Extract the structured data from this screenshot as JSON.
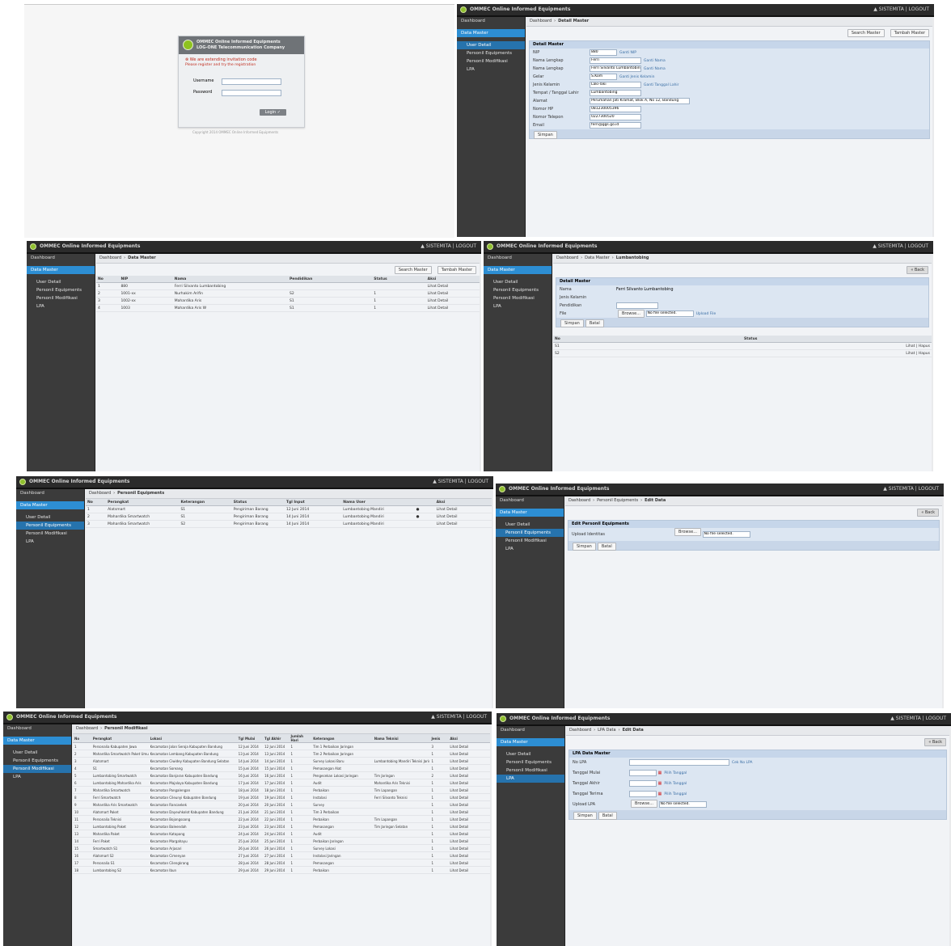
{
  "app": {
    "title": "OMMEC Online Informed Equipments",
    "user": "▲ SISTEMITA | LOGOUT"
  },
  "nav": {
    "dashboard": "Dashboard",
    "data_master": "Data Master",
    "user_detail": "User Detail",
    "personil_equipment": "Personil Equipments",
    "personil_modifikasi": "Personil Modifikasi",
    "lpa": "LPA"
  },
  "login": {
    "head_line1": "OMMEC Online Informed Equipments",
    "head_line2": "LOG-ONE Telecommunication Company",
    "error_line1": "⊗ We are extending invitation code",
    "error_line2": "Please register and try the registration",
    "username_label": "Username",
    "password_label": "Password",
    "login_button": "Login ✓",
    "footer": "Copyright 2014 OMMEC Online Informed Equipments"
  },
  "profile_form": {
    "crumb_home": "Dashboard",
    "crumb_current": "Detail Master",
    "btn_1": "Search Master",
    "btn_2": "Tambah Master",
    "section_title": "Detail Master",
    "fields": [
      {
        "label": "NIP",
        "value": "880"
      },
      {
        "label": "Nama Lengkap",
        "value": "Ferri"
      },
      {
        "label": "Nama Lengkap",
        "value": "Ferri Silvanto Lumbantobing"
      },
      {
        "label": "Gelar",
        "value": "S.Kom"
      },
      {
        "label": "Jenis Kelamin",
        "value": "Laki-laki"
      },
      {
        "label": "Tempat / Tanggal Lahir",
        "value": "Lumbantobing"
      },
      {
        "label": "Alamat",
        "value": "Perumahan Jati Kramat, Blok A, No 12, Bandung"
      },
      {
        "label": "Nomor HP",
        "value": "081230005396"
      },
      {
        "label": "Nomor Telepon",
        "value": "0227300520"
      },
      {
        "label": "Email",
        "value": "ferri@ggs.go.id"
      }
    ],
    "links": [
      "Ganti NIP",
      "Ganti Nama",
      "Ganti Nama",
      "Ganti Jenis Kelamin",
      "Ganti Tanggal Lahir"
    ],
    "save_button": "Simpan"
  },
  "user_list": {
    "crumb_home": "Dashboard",
    "crumb_current": "Data Master",
    "btn_1": "Search Master",
    "btn_2": "Tambah Master",
    "headers": [
      "No",
      "NIP",
      "Nama",
      "Pendidikan",
      "Status",
      "Aksi"
    ],
    "rows": [
      [
        "1",
        "880",
        "Ferri Silvanto Lumbantobing",
        "",
        "",
        "Lihat Detail"
      ],
      [
        "2",
        "1001-xx",
        "Nurhakim Arifin",
        "S2",
        "1",
        "Lihat Detail"
      ],
      [
        "3",
        "1002-xx",
        "Mahardika Aris",
        "S1",
        "1",
        "Lihat Detail"
      ],
      [
        "4",
        "1003",
        "Mahardika Aris W",
        "S1",
        "1",
        "Lihat Detail"
      ]
    ]
  },
  "user_detail": {
    "crumbs": [
      "Dashboard",
      "Data Master",
      "Lumbantobing"
    ],
    "back_button": "« Back",
    "section_title": "Detail Master",
    "fields": [
      {
        "label": "Nama",
        "value": "Ferri Silvanto Lumbantobing"
      },
      {
        "label": "Jenis Kelamin",
        "value": ""
      },
      {
        "label": "Pendidikan",
        "value": ""
      },
      {
        "label": "File",
        "value": "No file selected."
      }
    ],
    "browse_button": "Browse...",
    "upload_link": "Upload File",
    "btn_save": "Simpan",
    "btn_cancel": "Batal",
    "headers": [
      "No",
      "Status"
    ],
    "rows": [
      [
        "S1",
        "Lihat | Hapus"
      ],
      [
        "S2",
        "Lihat | Hapus"
      ]
    ]
  },
  "equip_list": {
    "crumb_home": "Dashboard",
    "crumb_current": "Personil Equipments",
    "headers": [
      "No",
      "Perangkat",
      "Keterangan",
      "Status",
      "Tgl Input",
      "Nama User",
      "",
      "Aksi"
    ],
    "rows": [
      [
        "1",
        "Alatsmart",
        "S1",
        "Pengiriman Barang",
        "12 Juni 2014",
        "Lumbantobing Mandiri",
        "●",
        "Lihat Detail"
      ],
      [
        "2",
        "Mahardika Smartwatch",
        "S1",
        "Pengiriman Barang",
        "14 Juni 2014",
        "Lumbantobing Mandiri",
        "●",
        "Lihat Detail"
      ],
      [
        "3",
        "Mahardika Smartwatch",
        "S2",
        "Pengiriman Barang",
        "14 Juni 2014",
        "Lumbantobing Mandiri",
        "",
        "Lihat Detail"
      ]
    ]
  },
  "equip_edit": {
    "crumbs": [
      "Dashboard",
      "Personil Equipments",
      "Edit Data"
    ],
    "back_button": "« Back",
    "section_title": "Edit Personil Equipments",
    "file_label": "Upload Identitas",
    "browse_button": "Browse...",
    "no_file": "No file selected.",
    "btn_save": "Simpan",
    "btn_cancel": "Batal"
  },
  "modif_list": {
    "crumb_home": "Dashboard",
    "crumb_current": "Personil Modifikasi",
    "headers": [
      "No",
      "Perangkat",
      "Lokasi",
      "Tgl Mulai",
      "Tgl Akhir",
      "Jumlah Hari",
      "Keterangan",
      "Nama Teknisi",
      "Jenis",
      "Aksi"
    ],
    "rows": [
      [
        "1",
        "Personalia Kabupaten Jawa",
        "Kecamatan Jalan Seroja Kabupaten Bandung",
        "12 Juni 2014",
        "12 Juni 2014",
        "1",
        "Tim 1 Perbaikan Jaringan",
        "",
        "3",
        "Lihat Detail"
      ],
      [
        "2",
        "Mahardika Smartwatch Paket Umum",
        "Kecamatan Lembang Kabupaten Bandung",
        "13 Juni 2014",
        "13 Juni 2014",
        "1",
        "Tim 2 Perbaikan Jaringan",
        "",
        "1",
        "Lihat Detail"
      ],
      [
        "3",
        "Alatsmart",
        "Kecamatan Ciwidey Kabupaten Bandung Selatan",
        "14 Juni 2014",
        "14 Juni 2014",
        "1",
        "Survey Lokasi Baru",
        "Lumbantobing Mandiri Teknisi Jaringan",
        "1",
        "Lihat Detail"
      ],
      [
        "4",
        "S1",
        "Kecamatan Soreang",
        "15 Juni 2014",
        "15 Juni 2014",
        "1",
        "Pemasangan Alat",
        "",
        "1",
        "Lihat Detail"
      ],
      [
        "5",
        "Lumbantobing Smartwatch",
        "Kecamatan Banjaran Kabupaten Bandung",
        "16 Juni 2014",
        "16 Juni 2014",
        "1",
        "Pengecekan Lokasi Jaringan",
        "Tim Jaringan",
        "2",
        "Lihat Detail"
      ],
      [
        "6",
        "Lumbantobing Mahardika Aris",
        "Kecamatan Majalaya Kabupaten Bandung",
        "17 Juni 2014",
        "17 Juni 2014",
        "1",
        "Audit",
        "Mahardika Aris Teknisi",
        "1",
        "Lihat Detail"
      ],
      [
        "7",
        "Mahardika Smartwatch",
        "Kecamatan Pangalengan",
        "18 Juni 2014",
        "18 Juni 2014",
        "1",
        "Perbaikan",
        "Tim Lapangan",
        "1",
        "Lihat Detail"
      ],
      [
        "8",
        "Ferri Smartwatch",
        "Kecamatan Cileunyi Kabupaten Bandung",
        "19 Juni 2014",
        "19 Juni 2014",
        "1",
        "Instalasi",
        "Ferri Silvanto Teknisi",
        "1",
        "Lihat Detail"
      ],
      [
        "9",
        "Mahardika Aris Smartwatch",
        "Kecamatan Rancaekek",
        "20 Juni 2014",
        "20 Juni 2014",
        "1",
        "Survey",
        "",
        "1",
        "Lihat Detail"
      ],
      [
        "10",
        "Alatsmart Paket",
        "Kecamatan Dayeuhkolot Kabupaten Bandung",
        "21 Juni 2014",
        "21 Juni 2014",
        "1",
        "Tim 3 Perbaikan",
        "",
        "1",
        "Lihat Detail"
      ],
      [
        "11",
        "Personalia Teknisi",
        "Kecamatan Bojongsoang",
        "22 Juni 2014",
        "22 Juni 2014",
        "1",
        "Perbaikan",
        "Tim Lapangan",
        "1",
        "Lihat Detail"
      ],
      [
        "12",
        "Lumbantobing Paket",
        "Kecamatan Baleendah",
        "23 Juni 2014",
        "23 Juni 2014",
        "1",
        "Pemasangan",
        "Tim Jaringan Selatan",
        "1",
        "Lihat Detail"
      ],
      [
        "13",
        "Mahardika Paket",
        "Kecamatan Katapang",
        "24 Juni 2014",
        "24 Juni 2014",
        "1",
        "Audit",
        "",
        "1",
        "Lihat Detail"
      ],
      [
        "14",
        "Ferri Paket",
        "Kecamatan Margahayu",
        "25 Juni 2014",
        "25 Juni 2014",
        "1",
        "Perbaikan Jaringan",
        "",
        "1",
        "Lihat Detail"
      ],
      [
        "15",
        "Smartwatch S1",
        "Kecamatan Arjasari",
        "26 Juni 2014",
        "26 Juni 2014",
        "1",
        "Survey Lokasi",
        "",
        "1",
        "Lihat Detail"
      ],
      [
        "16",
        "Alatsmart S2",
        "Kecamatan Cimenyan",
        "27 Juni 2014",
        "27 Juni 2014",
        "1",
        "Instalasi Jaringan",
        "",
        "1",
        "Lihat Detail"
      ],
      [
        "17",
        "Personalia S1",
        "Kecamatan Cilengkrang",
        "28 Juni 2014",
        "28 Juni 2014",
        "1",
        "Pemasangan",
        "",
        "1",
        "Lihat Detail"
      ],
      [
        "18",
        "Lumbantobing S2",
        "Kecamatan Ibun",
        "29 Juni 2014",
        "29 Juni 2014",
        "1",
        "Perbaikan",
        "",
        "1",
        "Lihat Detail"
      ]
    ]
  },
  "lpa_form": {
    "crumbs": [
      "Dashboard",
      "LPA Data",
      "Edit Data"
    ],
    "back_button": "« Back",
    "section_title": "LPA Data Master",
    "fields": [
      {
        "label": "No LPA",
        "value": ""
      },
      {
        "label": "Tanggal Mulai",
        "value": ""
      },
      {
        "label": "Tanggal Akhir",
        "value": ""
      },
      {
        "label": "Tanggal Terima",
        "value": ""
      },
      {
        "label": "Upload LPA",
        "value": "No file selected."
      }
    ],
    "links": [
      "Cek No LPA",
      "Pilih Tanggal",
      "Pilih Tanggal",
      "Pilih Tanggal"
    ],
    "browse_button": "Browse...",
    "btn_save": "Simpan",
    "btn_cancel": "Batal"
  }
}
